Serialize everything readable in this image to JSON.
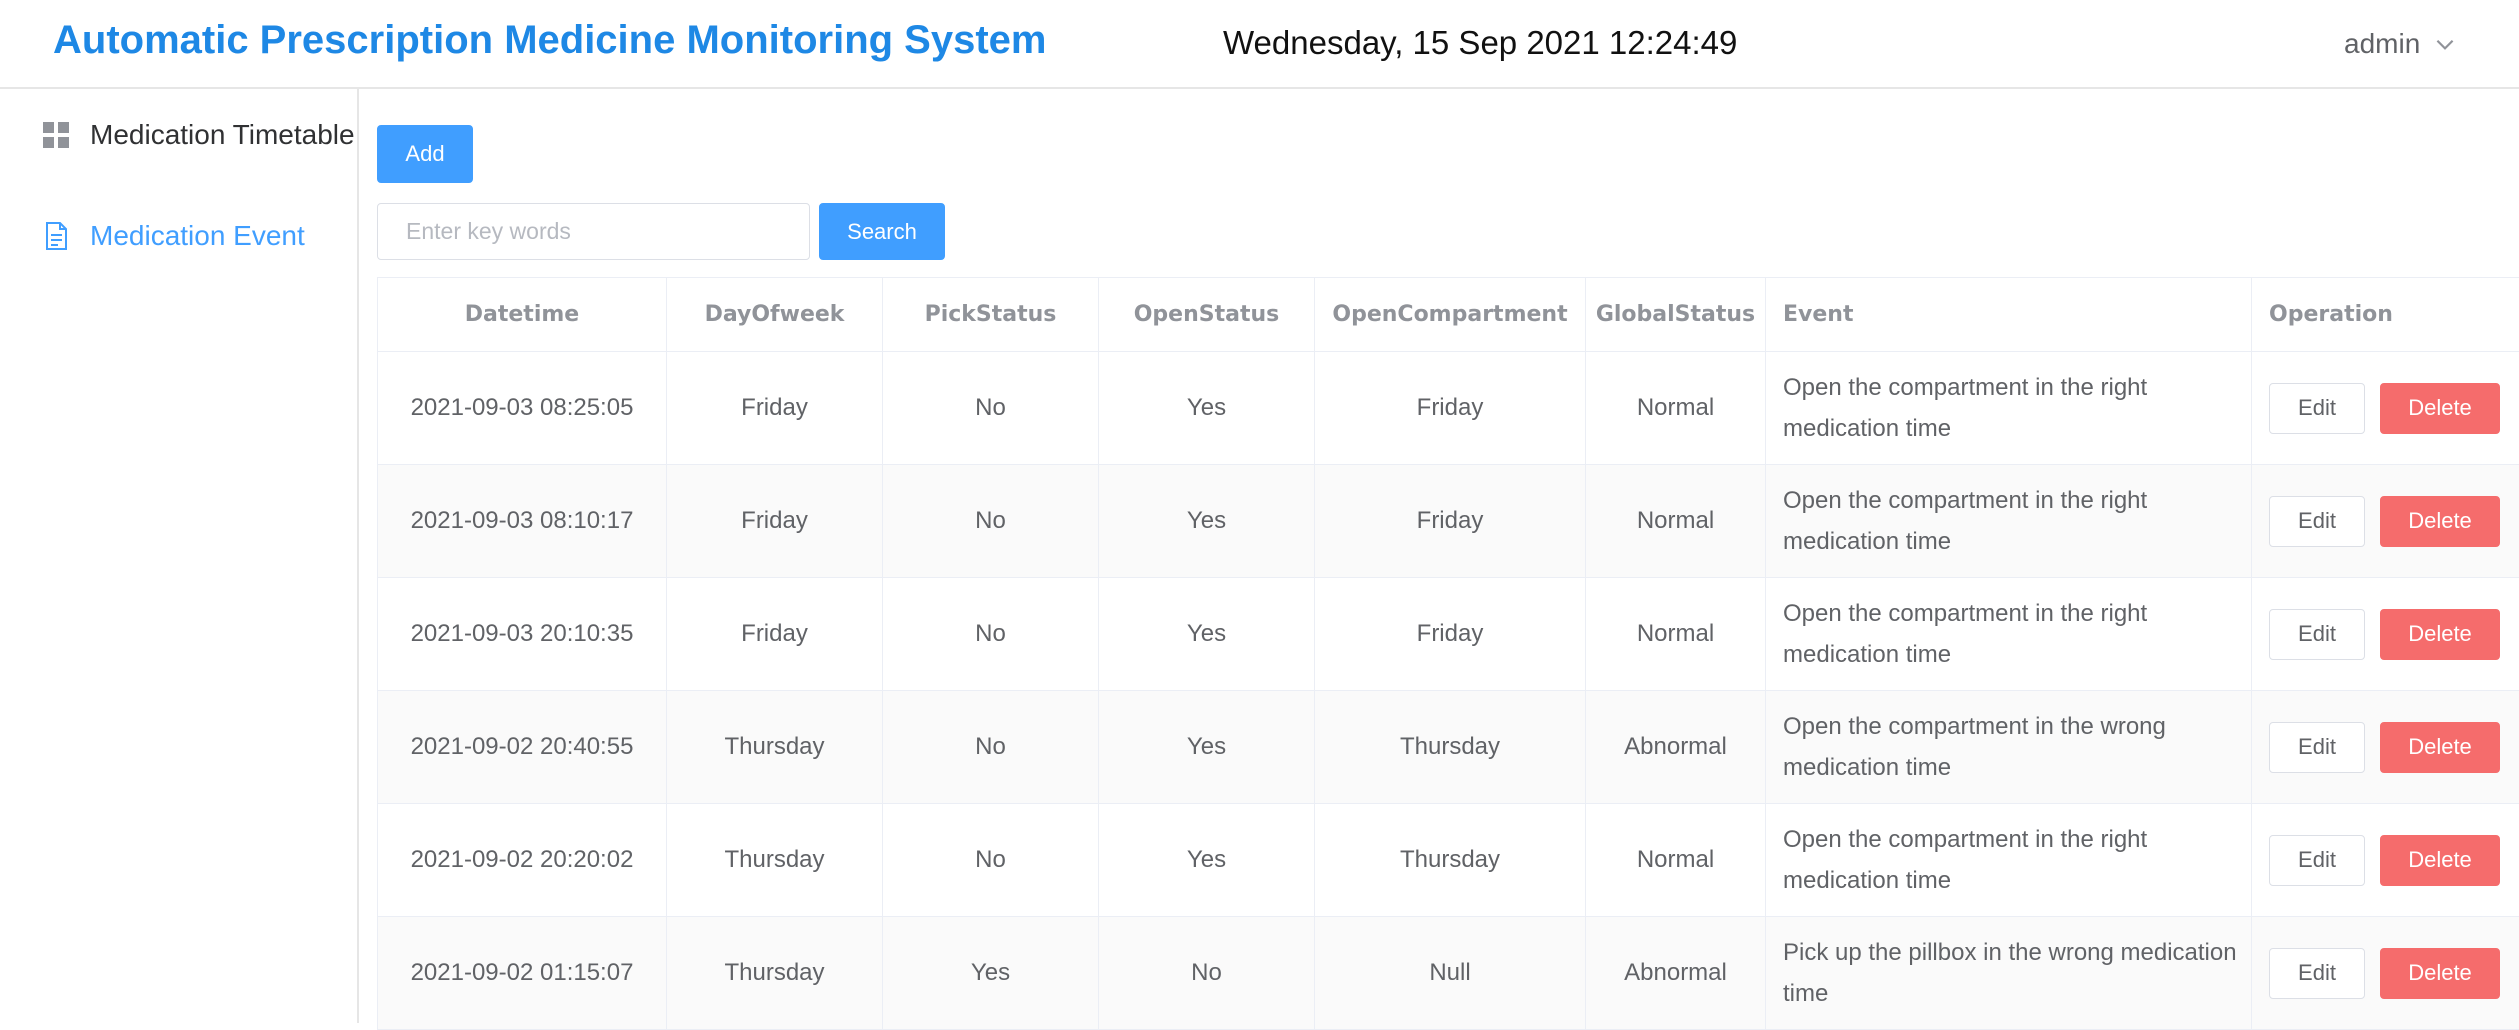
{
  "header": {
    "title": "Automatic Prescription Medicine Monitoring System",
    "datetime": "Wednesday, 15 Sep 2021 12:24:49",
    "user": "admin"
  },
  "sidebar": {
    "items": [
      {
        "label": "Medication Timetable",
        "icon": "grid-icon",
        "active": false
      },
      {
        "label": "Medication Event",
        "icon": "document-icon",
        "active": true
      }
    ]
  },
  "toolbar": {
    "add_label": "Add",
    "search_placeholder": "Enter key words",
    "search_value": "",
    "search_label": "Search"
  },
  "table": {
    "columns": [
      "Datetime",
      "DayOfweek",
      "PickStatus",
      "OpenStatus",
      "OpenCompartment",
      "GlobalStatus",
      "Event",
      "Operation"
    ],
    "edit_label": "Edit",
    "delete_label": "Delete",
    "rows": [
      {
        "datetime": "2021-09-03 08:25:05",
        "day": "Friday",
        "pick": "No",
        "open": "Yes",
        "compartment": "Friday",
        "global": "Normal",
        "event": "Open the compartment in the right medication time"
      },
      {
        "datetime": "2021-09-03 08:10:17",
        "day": "Friday",
        "pick": "No",
        "open": "Yes",
        "compartment": "Friday",
        "global": "Normal",
        "event": "Open the compartment in the right medication time"
      },
      {
        "datetime": "2021-09-03 20:10:35",
        "day": "Friday",
        "pick": "No",
        "open": "Yes",
        "compartment": "Friday",
        "global": "Normal",
        "event": "Open the compartment in the right medication time"
      },
      {
        "datetime": "2021-09-02 20:40:55",
        "day": "Thursday",
        "pick": "No",
        "open": "Yes",
        "compartment": "Thursday",
        "global": "Abnormal",
        "event": "Open the compartment in the wrong medication time"
      },
      {
        "datetime": "2021-09-02 20:20:02",
        "day": "Thursday",
        "pick": "No",
        "open": "Yes",
        "compartment": "Thursday",
        "global": "Normal",
        "event": "Open the compartment in the right medication time"
      },
      {
        "datetime": "2021-09-02 01:15:07",
        "day": "Thursday",
        "pick": "Yes",
        "open": "No",
        "compartment": "Null",
        "global": "Abnormal",
        "event": "Pick up the pillbox in the wrong medication time"
      }
    ]
  },
  "colors": {
    "brand": "#1e88e5",
    "primary": "#409eff",
    "danger": "#f56c6c"
  }
}
